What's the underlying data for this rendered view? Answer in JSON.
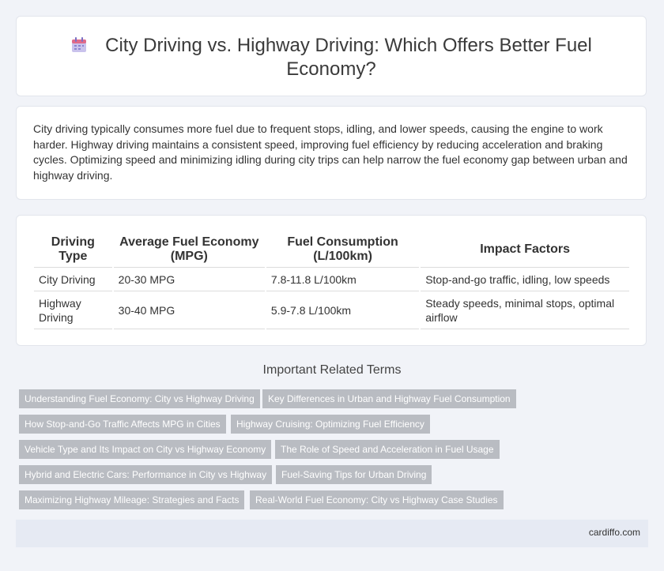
{
  "header": {
    "title": "City Driving vs. Highway Driving: Which Offers Better Fuel Economy?",
    "icon": "calendar-icon"
  },
  "summary": {
    "text": "City driving typically consumes more fuel due to frequent stops, idling, and lower speeds, causing the engine to work harder. Highway driving maintains a consistent speed, improving fuel efficiency by reducing acceleration and braking cycles. Optimizing speed and minimizing idling during city trips can help narrow the fuel economy gap between urban and highway driving."
  },
  "table": {
    "headers": [
      "Driving Type",
      "Average Fuel Economy (MPG)",
      "Fuel Consumption (L/100km)",
      "Impact Factors"
    ],
    "rows": [
      [
        "City Driving",
        "20-30 MPG",
        "7.8-11.8 L/100km",
        "Stop-and-go traffic, idling, low speeds"
      ],
      [
        "Highway Driving",
        "30-40 MPG",
        "5.9-7.8 L/100km",
        "Steady speeds, minimal stops, optimal airflow"
      ]
    ]
  },
  "related": {
    "heading": "Important Related Terms",
    "tags": [
      "Understanding Fuel Economy: City vs Highway Driving",
      "Key Differences in Urban and Highway Fuel Consumption",
      "How Stop-and-Go Traffic Affects MPG in Cities",
      "Highway Cruising: Optimizing Fuel Efficiency",
      "Vehicle Type and Its Impact on City vs Highway Economy",
      "The Role of Speed and Acceleration in Fuel Usage",
      "Hybrid and Electric Cars: Performance in City vs Highway",
      "Fuel-Saving Tips for Urban Driving",
      "Maximizing Highway Mileage: Strategies and Facts",
      "Real-World Fuel Economy: City vs Highway Case Studies"
    ]
  },
  "footer": {
    "site": "cardiffo.com"
  },
  "colors": {
    "tag_bg": "#b9bcc2",
    "page_bg": "#f1f3f8",
    "footer_bg": "#e6eaf3"
  }
}
